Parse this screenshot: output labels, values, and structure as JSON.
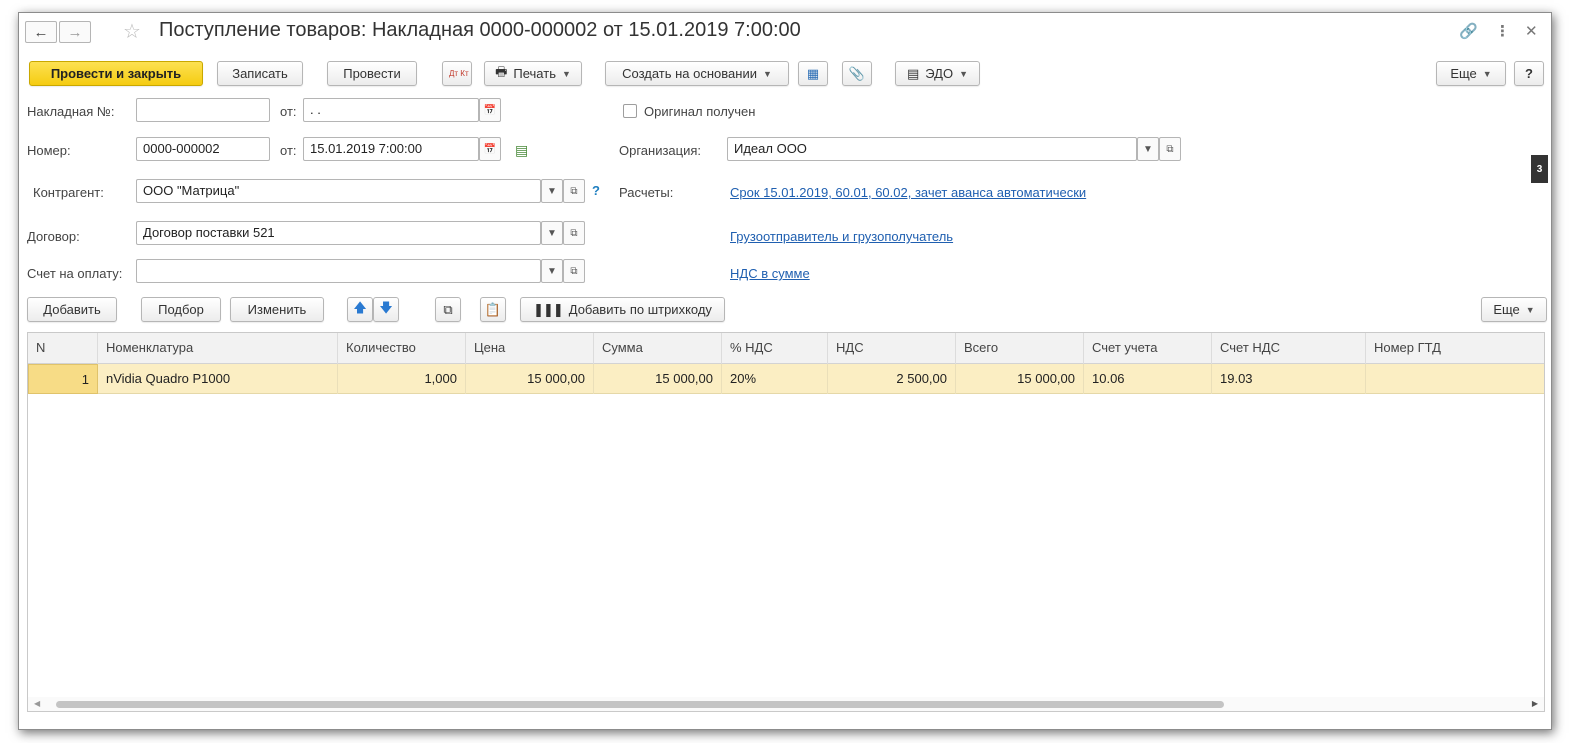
{
  "window": {
    "title": "Поступление товаров: Накладная 0000-000002 от 15.01.2019 7:00:00"
  },
  "toolbar": {
    "post_close": "Провести и закрыть",
    "save": "Записать",
    "post": "Провести",
    "dtkt": "Дт Кт",
    "print": "Печать",
    "create_based": "Создать на основании",
    "edo": "ЭДО",
    "more": "Еще",
    "help": "?"
  },
  "form": {
    "invoice_label": "Накладная №:",
    "invoice_value": "",
    "invoice_from_label": "от:",
    "invoice_date": " .  .",
    "original_received": "Оригинал получен",
    "number_label": "Номер:",
    "number_value": "0000-000002",
    "number_from_label": "от:",
    "number_date": "15.01.2019  7:00:00",
    "org_label": "Организация:",
    "org_value": "Идеал ООО",
    "counterparty_label": "Контрагент:",
    "counterparty_value": "ООО \"Матрица\"",
    "counterparty_help": "?",
    "settlements_label": "Расчеты:",
    "settlements_link": "Срок 15.01.2019, 60.01, 60.02, зачет аванса автоматически",
    "contract_label": "Договор:",
    "contract_value": "Договор поставки 521",
    "shipper_link": "Грузоотправитель и грузополучатель",
    "invoice_pay_label": "Счет на оплату:",
    "invoice_pay_value": "",
    "vat_link": "НДС в сумме"
  },
  "table_toolbar": {
    "add": "Добавить",
    "pick": "Подбор",
    "edit": "Изменить",
    "barcode": "Добавить по штрихкоду",
    "more": "Еще"
  },
  "table": {
    "columns": [
      "N",
      "Номенклатура",
      "Количество",
      "Цена",
      "Сумма",
      "% НДС",
      "НДС",
      "Всего",
      "Счет учета",
      "Счет НДС",
      "Номер ГТД"
    ],
    "rows": [
      [
        "1",
        "nVidia Quadro P1000",
        "1,000",
        "15 000,00",
        "15 000,00",
        "20%",
        "2 500,00",
        "15 000,00",
        "10.06",
        "19.03",
        ""
      ]
    ]
  },
  "side_tab": "3",
  "colors": {
    "primary_button": "#f5cc11",
    "link": "#1f5fb0",
    "selected_row": "#fbeec3"
  }
}
